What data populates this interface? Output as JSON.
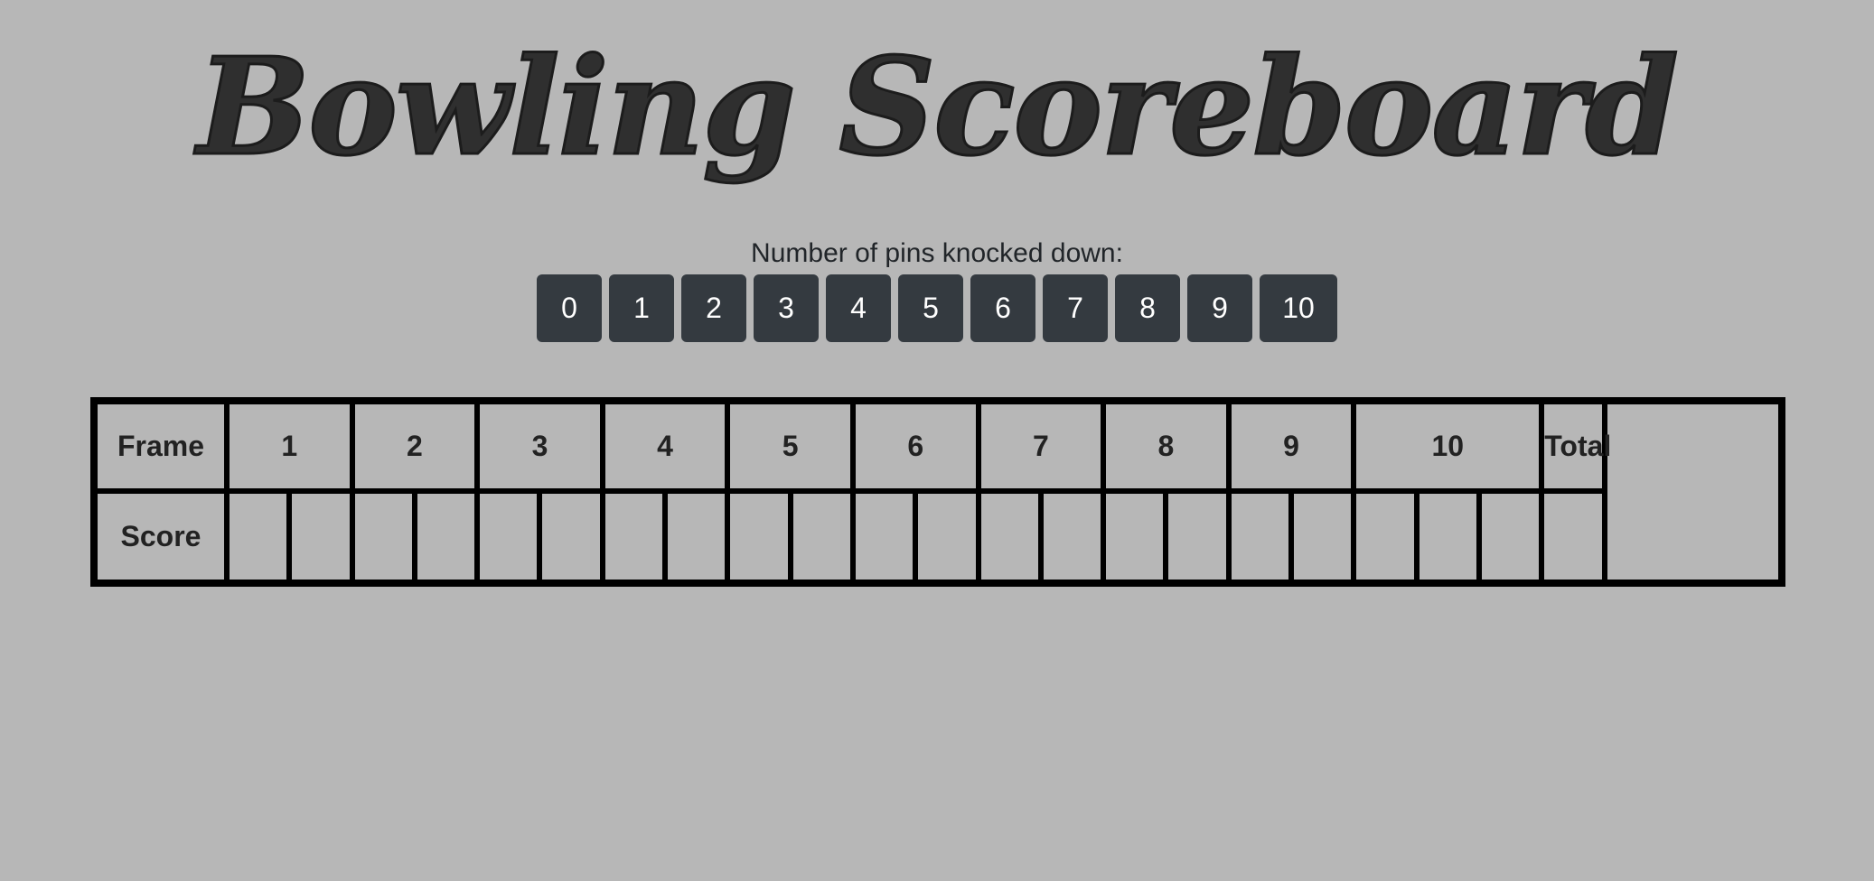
{
  "header": {
    "title": "Bowling Scoreboard"
  },
  "pins": {
    "label": "Number of pins knocked down:",
    "buttons": [
      "0",
      "1",
      "2",
      "3",
      "4",
      "5",
      "6",
      "7",
      "8",
      "9",
      "10"
    ]
  },
  "scoreboard": {
    "frame_label": "Frame",
    "score_label": "Score",
    "frames": [
      "1",
      "2",
      "3",
      "4",
      "5",
      "6",
      "7",
      "8",
      "9",
      "10"
    ],
    "total_label": "Total",
    "rolls": [
      "",
      "",
      "",
      "",
      "",
      "",
      "",
      "",
      "",
      "",
      "",
      "",
      "",
      "",
      "",
      "",
      "",
      "",
      "",
      "",
      ""
    ],
    "total_value": ""
  },
  "colors": {
    "background": "#b7b7b7",
    "button": "#343a40",
    "button_text": "#ffffff",
    "border": "#000000"
  }
}
